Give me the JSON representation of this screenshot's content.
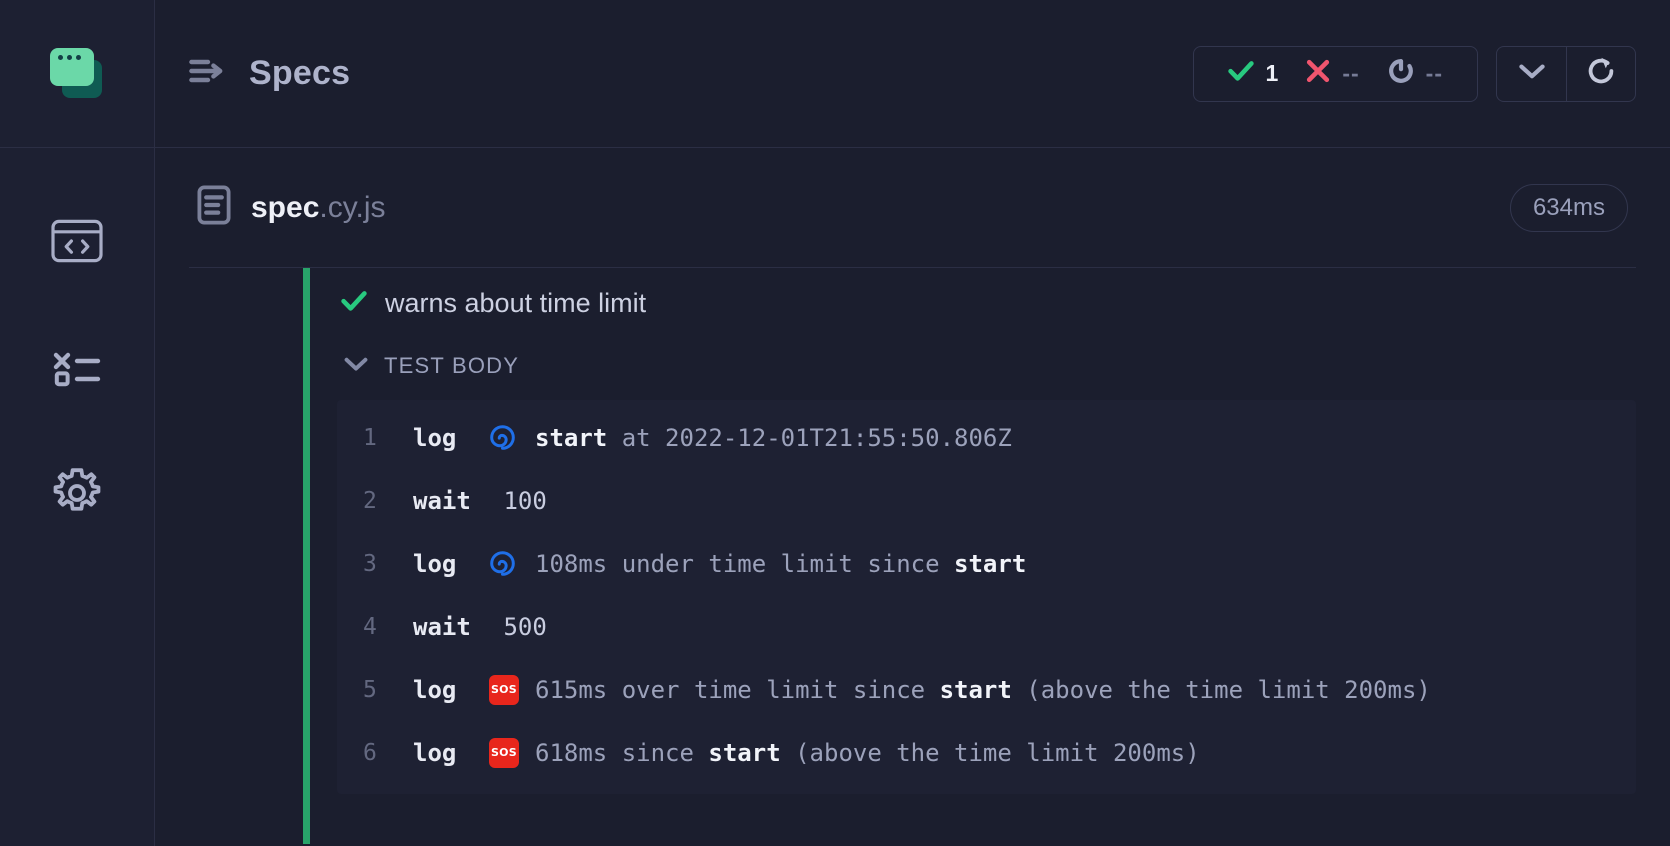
{
  "brand": {
    "icon": "cypress-logo-icon"
  },
  "sidebar": {
    "items": [
      {
        "name": "specs-nav",
        "icon": "code-window-icon"
      },
      {
        "name": "runs-nav",
        "icon": "test-results-list-icon"
      },
      {
        "name": "settings-nav",
        "icon": "gear-icon"
      }
    ]
  },
  "header": {
    "menu_icon": "menu-arrow-icon",
    "title": "Specs",
    "stats": [
      {
        "key": "passed",
        "icon": "check-icon",
        "value": "1",
        "color": "#28c97f",
        "dim": false
      },
      {
        "key": "failed",
        "icon": "x-icon",
        "value": "--",
        "color": "#f0556e",
        "dim": true
      },
      {
        "key": "pending",
        "icon": "circle-arrow-icon",
        "value": "--",
        "color": "#9aa0bb",
        "dim": true
      }
    ],
    "chevron_button": {
      "icon": "chevron-down-icon"
    },
    "reload_button": {
      "icon": "reload-icon"
    }
  },
  "spec": {
    "file_icon": "file-document-icon",
    "name": "spec",
    "extension": ".cy.js",
    "duration": "634ms"
  },
  "test": {
    "status_icon": "check-icon",
    "title": "warns about time limit",
    "body_toggle_icon": "chevron-down-icon",
    "body_label": "TEST BODY",
    "commands": [
      {
        "num": "1",
        "name": "log",
        "emoji": "spiral",
        "parts": [
          {
            "text": "start",
            "bold": true
          },
          {
            "text": " at ",
            "bold": false
          },
          {
            "text": "2022-12-01T21:55:50.806Z",
            "bold": false
          }
        ]
      },
      {
        "num": "2",
        "name": "wait",
        "emoji": "",
        "parts": [
          {
            "text": " 100",
            "bold": false,
            "arg": true
          }
        ]
      },
      {
        "num": "3",
        "name": "log",
        "emoji": "spiral",
        "parts": [
          {
            "text": "108ms under time limit since ",
            "bold": false
          },
          {
            "text": "start",
            "bold": true
          }
        ]
      },
      {
        "num": "4",
        "name": "wait",
        "emoji": "",
        "parts": [
          {
            "text": " 500",
            "bold": false,
            "arg": true
          }
        ]
      },
      {
        "num": "5",
        "name": "log",
        "emoji": "sos",
        "parts": [
          {
            "text": "615ms over time limit since ",
            "bold": false
          },
          {
            "text": "start",
            "bold": true
          },
          {
            "text": " (above the time limit 200ms)",
            "bold": false
          }
        ]
      },
      {
        "num": "6",
        "name": "log",
        "emoji": "sos",
        "parts": [
          {
            "text": "618ms since ",
            "bold": false
          },
          {
            "text": "start",
            "bold": true
          },
          {
            "text": " (above the time limit 200ms)",
            "bold": false
          }
        ]
      }
    ]
  },
  "colors": {
    "background": "#1b1e2e",
    "sidebar": "#1d2032",
    "panel": "#1e2133",
    "border": "#2b2e44",
    "accent_green": "#28a46a",
    "pass_green": "#28c97f",
    "fail_red": "#f0556e",
    "text_primary": "#eef0f7",
    "text_muted": "#9aa0bb",
    "sos_red": "#e8261c",
    "spiral_blue": "#1f6fe8"
  }
}
